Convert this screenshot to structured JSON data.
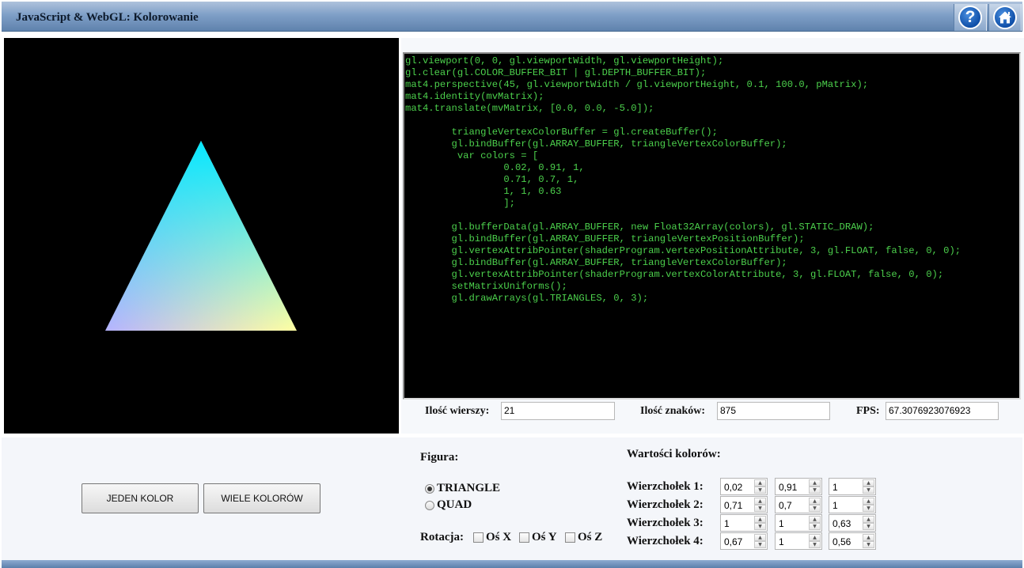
{
  "header": {
    "title": "JavaScript & WebGL: Kolorowanie",
    "help_icon": "?",
    "home_icon": "home-icon"
  },
  "editor": {
    "lines": [
      "gl.viewport(0, 0, gl.viewportWidth, gl.viewportHeight);",
      "gl.clear(gl.COLOR_BUFFER_BIT | gl.DEPTH_BUFFER_BIT);",
      "mat4.perspective(45, gl.viewportWidth / gl.viewportHeight, 0.1, 100.0, pMatrix);",
      "mat4.identity(mvMatrix);",
      "mat4.translate(mvMatrix, [0.0, 0.0, -5.0]);",
      "",
      "        triangleVertexColorBuffer = gl.createBuffer();",
      "        gl.bindBuffer(gl.ARRAY_BUFFER, triangleVertexColorBuffer);",
      "         var colors = [",
      "                 0.02, 0.91, 1,",
      "                 0.71, 0.7, 1,",
      "                 1, 1, 0.63",
      "                 ];",
      "",
      "        gl.bufferData(gl.ARRAY_BUFFER, new Float32Array(colors), gl.STATIC_DRAW);",
      "        gl.bindBuffer(gl.ARRAY_BUFFER, triangleVertexPositionBuffer);",
      "        gl.vertexAttribPointer(shaderProgram.vertexPositionAttribute, 3, gl.FLOAT, false, 0, 0);",
      "        gl.bindBuffer(gl.ARRAY_BUFFER, triangleVertexColorBuffer);",
      "        gl.vertexAttribPointer(shaderProgram.vertexColorAttribute, 3, gl.FLOAT, false, 0, 0);",
      "        setMatrixUniforms();",
      "        gl.drawArrays(gl.TRIANGLES, 0, 3);"
    ],
    "text_color": "#4cd04c"
  },
  "stats": {
    "rows_label": "Ilość wierszy:",
    "rows_value": "21",
    "chars_label": "Ilość znaków:",
    "chars_value": "875",
    "fps_label": "FPS:",
    "fps_value": "67.3076923076923"
  },
  "buttons": {
    "one_color": "JEDEN KOLOR",
    "many_colors": "WIELE KOLORÓW"
  },
  "figure": {
    "label": "Figura:",
    "options": [
      "TRIANGLE",
      "QUAD"
    ],
    "selected": "TRIANGLE"
  },
  "rotation": {
    "label": "Rotacja:",
    "axes": [
      "Oś X",
      "Oś Y",
      "Oś Z"
    ]
  },
  "colors": {
    "title": "Wartości kolorów:",
    "vertices": [
      {
        "label": "Wierzchołek 1:",
        "values": [
          "0,02",
          "0,91",
          "1"
        ]
      },
      {
        "label": "Wierzchołek 2:",
        "values": [
          "0,71",
          "0,7",
          "1"
        ]
      },
      {
        "label": "Wierzchołek 3:",
        "values": [
          "1",
          "1",
          "0,63"
        ]
      },
      {
        "label": "Wierzchołek 4:",
        "values": [
          "0,67",
          "1",
          "0,56"
        ]
      }
    ]
  },
  "canvas": {
    "background": "#000000",
    "vertex_colors": [
      "#05e8ff",
      "#b5b3ff",
      "#ffffa1"
    ]
  }
}
